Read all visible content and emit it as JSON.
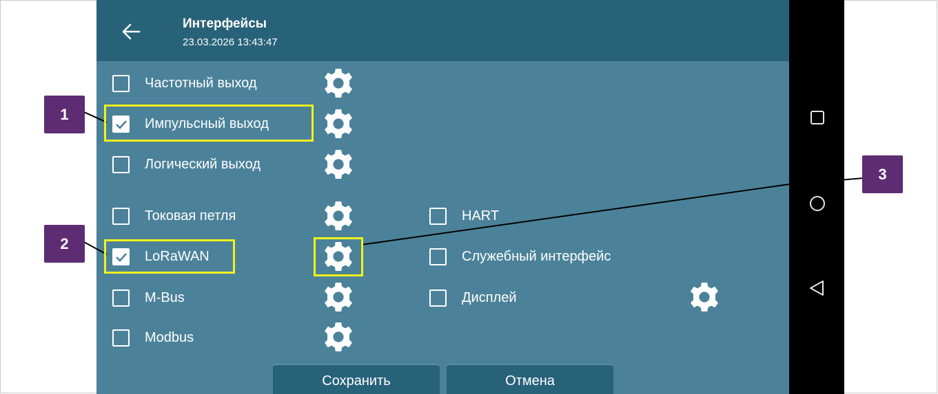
{
  "header": {
    "title": "Интерфейсы",
    "timestamp": "23.03.2026 13:43:47"
  },
  "options_left": [
    {
      "label": "Частотный выход",
      "checked": false
    },
    {
      "label": "Импульсный выход",
      "checked": true
    },
    {
      "label": "Логический выход",
      "checked": false
    },
    {
      "label": "Токовая петля",
      "checked": false
    },
    {
      "label": "LoRaWAN",
      "checked": true
    },
    {
      "label": "M-Bus",
      "checked": false
    },
    {
      "label": "Modbus",
      "checked": false
    }
  ],
  "options_right": [
    {
      "label": "HART",
      "checked": false
    },
    {
      "label": "Служебный интерфейс",
      "checked": false
    },
    {
      "label": "Дисплей",
      "checked": false
    }
  ],
  "buttons": {
    "save": "Сохранить",
    "cancel": "Отмена"
  },
  "callouts": [
    "1",
    "2",
    "3"
  ],
  "colors": {
    "screen_bg": "#4b8299",
    "appbar_bg": "#286279",
    "highlight": "#f2f21b",
    "callout_bg": "#5d2c73"
  },
  "icons": [
    "back-arrow-icon",
    "gear-icon",
    "checkmark-icon",
    "square-nav-icon",
    "circle-nav-icon",
    "triangle-nav-icon"
  ]
}
